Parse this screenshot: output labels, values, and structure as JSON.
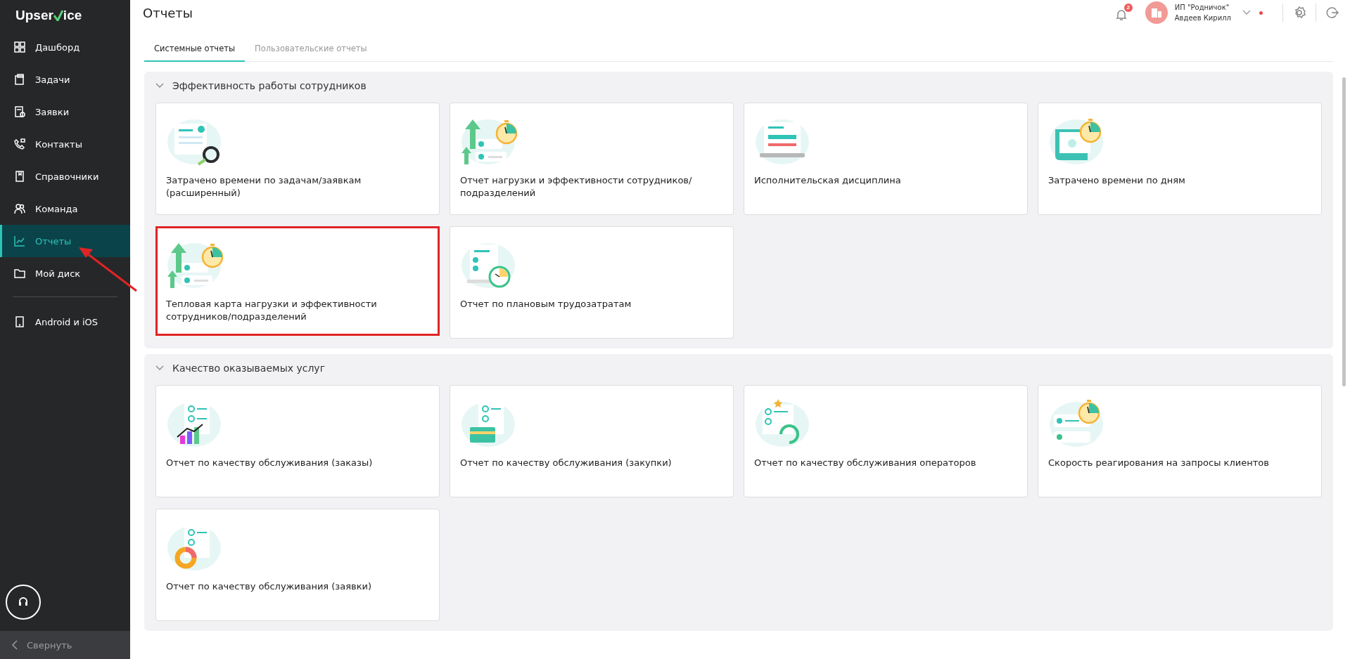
{
  "sidebar": {
    "logo": {
      "before": "Upser",
      "after": "ice"
    },
    "items": [
      {
        "label": "Дашборд",
        "kind": "grid",
        "selected": false
      },
      {
        "label": "Задачи",
        "kind": "clipboard",
        "selected": false
      },
      {
        "label": "Заявки",
        "kind": "request",
        "selected": false
      },
      {
        "label": "Контакты",
        "kind": "phone",
        "selected": false
      },
      {
        "label": "Справочники",
        "kind": "book",
        "selected": false
      },
      {
        "label": "Команда",
        "kind": "team",
        "selected": false
      },
      {
        "label": "Отчеты",
        "kind": "chart",
        "selected": true
      },
      {
        "label": "Мой диск",
        "kind": "folder",
        "selected": false
      }
    ],
    "apps": {
      "label": "Android и iOS"
    },
    "collapse": {
      "label": "Свернуть"
    }
  },
  "header": {
    "title": "Отчеты",
    "notifications": "2",
    "company": "ИП \"Родничок\"",
    "user": "Авдеев Кирилл"
  },
  "tabs": [
    {
      "label": "Системные отчеты",
      "selected": true
    },
    {
      "label": "Пользовательские отчеты",
      "selected": false
    }
  ],
  "sections": [
    {
      "title": "Эффективность работы сотрудников",
      "expanded": true,
      "cards": [
        {
          "title": "Затрачено времени по задачам/заявкам (расширенный)",
          "kind": "checklist",
          "highlighted": false
        },
        {
          "title": "Отчет нагрузки и эффективности сотрудников/ подразделений",
          "kind": "growth",
          "highlighted": false
        },
        {
          "title": "Исполнительская дисциплина",
          "kind": "laptop",
          "highlighted": false
        },
        {
          "title": "Затрачено времени по дням",
          "kind": "calendar",
          "highlighted": false
        },
        {
          "title": "Тепловая карта нагрузки и эффективности сотрудников/подразделений",
          "kind": "growth",
          "highlighted": true
        },
        {
          "title": "Отчет по плановым трудозатратам",
          "kind": "plan",
          "highlighted": false
        }
      ]
    },
    {
      "title": "Качество оказываемых услуг",
      "expanded": true,
      "cards": [
        {
          "title": "Отчет по качеству обслуживания (заказы)",
          "kind": "bars",
          "highlighted": false
        },
        {
          "title": "Отчет по качеству обслуживания (закупки)",
          "kind": "card",
          "highlighted": false
        },
        {
          "title": "Отчет по качеству обслуживания операторов",
          "kind": "headset",
          "highlighted": false
        },
        {
          "title": "Скорость реагирования на запросы клиентов",
          "kind": "speed",
          "highlighted": false
        },
        {
          "title": "Отчет по качеству обслуживания (заявки)",
          "kind": "donut",
          "highlighted": false
        }
      ]
    }
  ]
}
